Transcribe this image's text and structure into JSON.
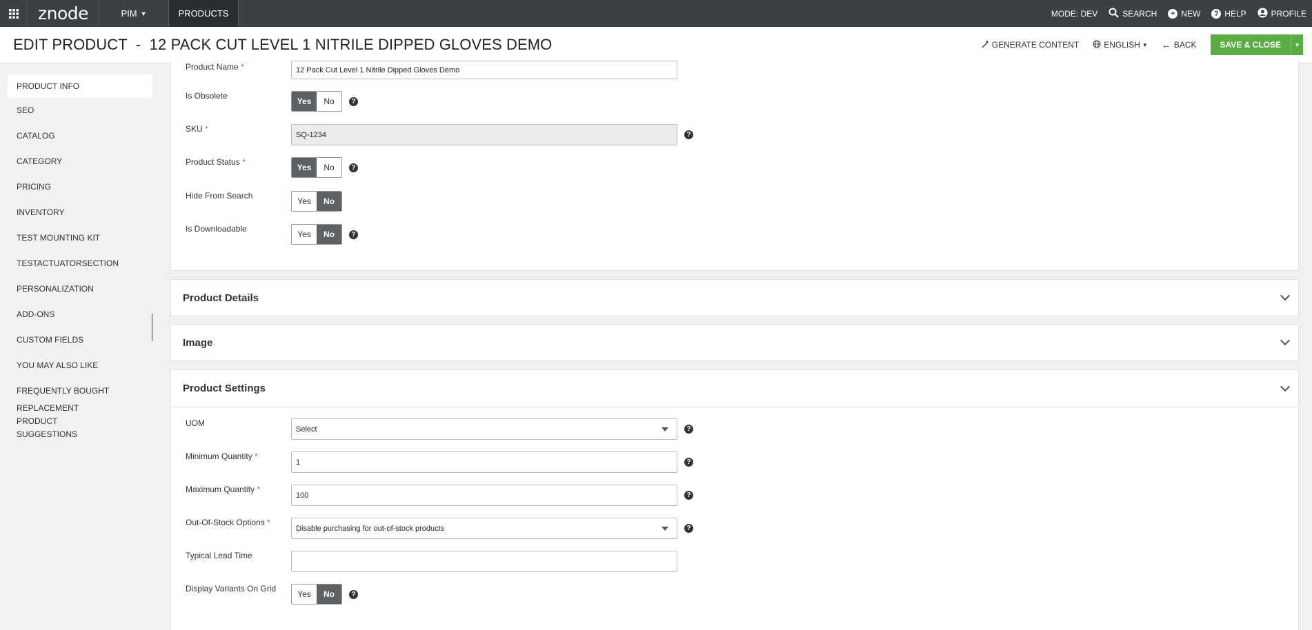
{
  "topbar": {
    "logo": "znode",
    "nav": [
      {
        "label": "PIM"
      },
      {
        "label": "PRODUCTS"
      }
    ],
    "mode": "MODE: DEV",
    "search": "SEARCH",
    "new": "NEW",
    "help": "HELP",
    "profile": "PROFILE"
  },
  "header": {
    "title": "EDIT PRODUCT  -  12 PACK CUT LEVEL 1 NITRILE DIPPED GLOVES DEMO",
    "generate": "GENERATE CONTENT",
    "language": "ENGLISH",
    "back": "BACK",
    "save": "SAVE & CLOSE"
  },
  "sidebar": {
    "items": [
      {
        "label": "PRODUCT INFO"
      },
      {
        "label": "SEO"
      },
      {
        "label": "CATALOG"
      },
      {
        "label": "CATEGORY"
      },
      {
        "label": "PRICING"
      },
      {
        "label": "INVENTORY"
      },
      {
        "label": "TEST MOUNTING KIT"
      },
      {
        "label": "TESTACTUATORSECTION"
      },
      {
        "label": "PERSONALIZATION"
      },
      {
        "label": "ADD-ONS"
      },
      {
        "label": "CUSTOM FIELDS"
      },
      {
        "label": "YOU MAY ALSO LIKE"
      },
      {
        "label": "FREQUENTLY BOUGHT"
      },
      {
        "label": "REPLACEMENT PRODUCT SUGGESTIONS"
      }
    ]
  },
  "form": {
    "product_name": {
      "label": "Product Name",
      "value": "12 Pack Cut Level 1 Nitrile Dipped Gloves Demo"
    },
    "is_obsolete": {
      "label": "Is Obsolete",
      "yes": "Yes",
      "no": "No",
      "selected": "Yes"
    },
    "sku": {
      "label": "SKU",
      "value": "SQ-1234"
    },
    "product_status": {
      "label": "Product Status",
      "yes": "Yes",
      "no": "No",
      "selected": "Yes"
    },
    "hide_from_search": {
      "label": "Hide From Search",
      "yes": "Yes",
      "no": "No",
      "selected": "No"
    },
    "is_downloadable": {
      "label": "Is Downloadable",
      "yes": "Yes",
      "no": "No",
      "selected": "No"
    }
  },
  "sections": {
    "product_details": "Product Details",
    "image": "Image",
    "product_settings": "Product Settings"
  },
  "settings": {
    "uom": {
      "label": "UOM",
      "value": "Select"
    },
    "min_qty": {
      "label": "Minimum Quantity",
      "value": "1"
    },
    "max_qty": {
      "label": "Maximum Quantity",
      "value": "100"
    },
    "oos": {
      "label": "Out-Of-Stock Options",
      "value": "Disable purchasing for out-of-stock products"
    },
    "lead_time": {
      "label": "Typical Lead Time",
      "value": ""
    },
    "display_variants": {
      "label": "Display Variants On Grid",
      "yes": "Yes",
      "no": "No",
      "selected": "No"
    }
  },
  "required_marker": "*",
  "help_glyph": "?"
}
